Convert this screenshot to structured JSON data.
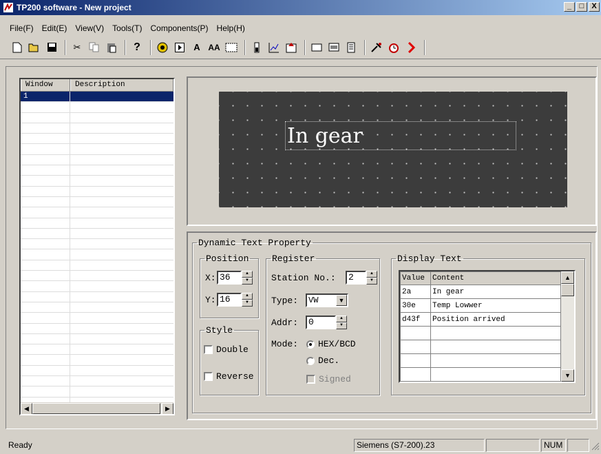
{
  "window": {
    "title": "TP200 software - New project",
    "minimize": "_",
    "maximize": "□",
    "close": "X"
  },
  "menu": [
    "File(F)",
    "Edit(E)",
    "View(V)",
    "Tools(T)",
    "Components(P)",
    "Help(H)"
  ],
  "toolbar": {
    "icons": [
      "new-icon",
      "open-icon",
      "save-icon",
      "cut-icon",
      "copy-icon",
      "paste-icon",
      "help-icon",
      "record-icon",
      "play-icon",
      "text-icon",
      "big-text-icon",
      "bitmap-icon",
      "bar-icon",
      "trend-icon",
      "alarm-icon",
      "window-icon",
      "screen-icon",
      "recipe-icon",
      "tools-icon",
      "clock-icon",
      "download-icon"
    ],
    "text_a": "A",
    "text_aa": "AA"
  },
  "window_list": {
    "columns": [
      "Window",
      "Description"
    ],
    "rows": [
      {
        "window": "1",
        "description": ""
      }
    ],
    "empty_rows": 30
  },
  "preview": {
    "text": "In gear"
  },
  "props": {
    "title": "Dynamic Text Property",
    "position": {
      "title": "Position",
      "x_label": "X:",
      "x_value": "36",
      "y_label": "Y:",
      "y_value": "16"
    },
    "style": {
      "title": "Style",
      "double": "Double",
      "reverse": "Reverse"
    },
    "register": {
      "title": "Register",
      "station_label": "Station No.:",
      "station_value": "2",
      "type_label": "Type:",
      "type_value": "VW",
      "addr_label": "Addr:",
      "addr_value": "0",
      "mode_label": "Mode:",
      "mode_hex": "HEX/BCD",
      "mode_dec": "Dec.",
      "signed": "Signed"
    },
    "display_text": {
      "title": "Display Text",
      "columns": [
        "Value",
        "Content"
      ],
      "rows": [
        {
          "value": "2a",
          "content": "In gear"
        },
        {
          "value": "30e",
          "content": "Temp Lowwer"
        },
        {
          "value": "d43f",
          "content": "Position arrived"
        },
        {
          "value": "",
          "content": ""
        },
        {
          "value": "",
          "content": ""
        },
        {
          "value": "",
          "content": ""
        },
        {
          "value": "",
          "content": ""
        }
      ]
    }
  },
  "status": {
    "ready": "Ready",
    "plc": "Siemens (S7-200).23",
    "num": "NUM"
  }
}
